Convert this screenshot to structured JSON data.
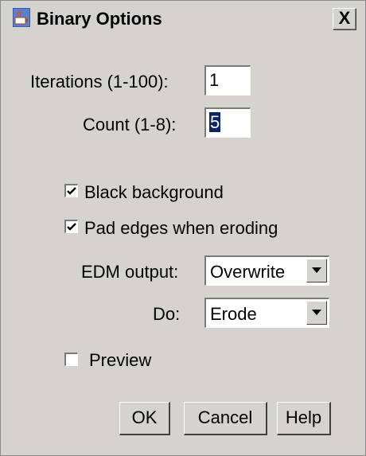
{
  "window": {
    "title": "Binary Options",
    "close_label": "X"
  },
  "fields": {
    "iterations_label": "Iterations (1-100):",
    "iterations_value": "1",
    "count_label": "Count (1-8):",
    "count_value": "5"
  },
  "checkboxes": {
    "black_background": {
      "label": "Black background",
      "checked": true
    },
    "pad_edges": {
      "label": "Pad edges when eroding",
      "checked": true
    },
    "preview": {
      "label": "Preview",
      "checked": false
    }
  },
  "selects": {
    "edm_output_label": "EDM output:",
    "edm_output_value": "Overwrite",
    "do_label": "Do:",
    "do_value": "Erode"
  },
  "buttons": {
    "ok": "OK",
    "cancel": "Cancel",
    "help": "Help"
  },
  "icons": {
    "app": "java-coffee-icon",
    "close": "close-icon",
    "check": "check-icon",
    "dropdown": "chevron-down-icon"
  }
}
